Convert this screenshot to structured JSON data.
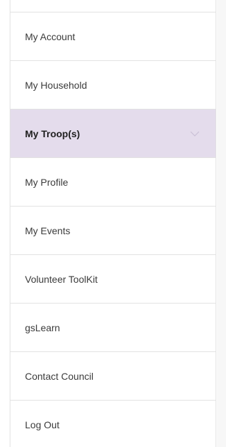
{
  "menu": {
    "items": [
      {
        "label": "My Account"
      },
      {
        "label": "My Household"
      },
      {
        "label": "My Troop(s)",
        "active": true,
        "icon": "chevron-down-icon"
      },
      {
        "label": "My Profile"
      },
      {
        "label": "My Events"
      },
      {
        "label": "Volunteer ToolKit"
      },
      {
        "label": "gsLearn"
      },
      {
        "label": "Contact Council"
      },
      {
        "label": "Log Out"
      }
    ]
  },
  "colors": {
    "active_bg": "#e4dcec",
    "divider": "#e2e2e2",
    "text": "#3a3a3a"
  }
}
